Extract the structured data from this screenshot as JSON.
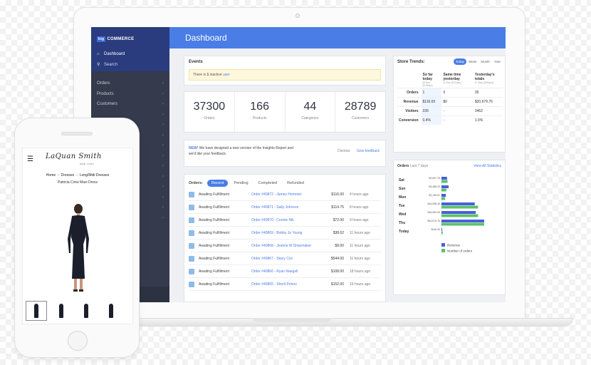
{
  "sidebar": {
    "logo_badge": "big",
    "logo_text": "COMMERCE",
    "dashboard_label": "Dashboard",
    "search_label": "Search",
    "items": [
      "Orders",
      "Products",
      "Customers",
      "",
      "",
      "",
      "",
      "",
      "",
      "",
      "",
      "",
      "",
      ""
    ]
  },
  "header": {
    "title": "Dashboard"
  },
  "events": {
    "title": "Events",
    "alert_pre": "There is",
    "alert_num": "1",
    "alert_mid": "inactive",
    "alert_link": "user"
  },
  "stats": [
    {
      "value": "37300",
      "label": "Orders"
    },
    {
      "value": "166",
      "label": "Products"
    },
    {
      "value": "44",
      "label": "Categories"
    },
    {
      "value": "28789",
      "label": "Customers"
    }
  ],
  "news": {
    "tag": "NEW!",
    "line1": "We have designed a new version of the Insights Report and",
    "line2": "we'd like your feedback.",
    "dismiss": "Dismiss",
    "feedback": "Give feedback"
  },
  "orders": {
    "title": "Orders:",
    "tabs": [
      "Recent",
      "Pending",
      "Completed",
      "Refunded"
    ],
    "rows": [
      {
        "status": "Awaiting Fulfillment",
        "order": "Order #40872 - James Hommer",
        "amount": "$116.00",
        "ago": "4 hours ago"
      },
      {
        "status": "Awaiting Fulfillment",
        "order": "Order #40871 - Sally Johnson",
        "amount": "$114.75",
        "ago": "8 hours ago"
      },
      {
        "status": "Awaiting Fulfillment",
        "order": "Order #40870 - Connie Nik",
        "amount": "$72.00",
        "ago": "9 hours ago"
      },
      {
        "status": "Awaiting Fulfillment",
        "order": "Order #40869 - Bobby Jo Young",
        "amount": "$38.62",
        "ago": "11 hours ago"
      },
      {
        "status": "Awaiting Fulfillment",
        "order": "Order #40868 - Jeanne M Shoemaker",
        "amount": "$9.00",
        "ago": "11 hours ago"
      },
      {
        "status": "Awaiting Fulfillment",
        "order": "Order #40867 - Stacy Cox",
        "amount": "$544.00",
        "ago": "11 hours ago"
      },
      {
        "status": "Awaiting Fulfillment",
        "order": "Order #40866 - Ryan Naegell",
        "amount": "$108.00",
        "ago": "18 hours ago"
      },
      {
        "status": "Awaiting Fulfillment",
        "order": "Order #40865 - Sheril Peters",
        "amount": "$152.00",
        "ago": "19 hours ago"
      }
    ]
  },
  "trends": {
    "title": "Store Trends:",
    "tabs": [
      "Today",
      "Week",
      "Month",
      "Year"
    ],
    "col1": "So far today",
    "col1_sub": "(8 Dec (5:24am)",
    "col2": "Same time yesterday",
    "col2_sub": "(7 Dec (5:24am)",
    "col3": "Yesterday's totals",
    "col3_sub": "(7 Dec) (5:50pm)",
    "rows": [
      {
        "label": "Orders",
        "a": "1",
        "b": "0",
        "c": "35"
      },
      {
        "label": "Revenue",
        "a": "$116.00",
        "b": "$0",
        "c": "$20,679.76"
      },
      {
        "label": "Visitors",
        "a": "235",
        "b": "-",
        "c": "3462"
      },
      {
        "label": "Conversion",
        "a": "0.4%",
        "b": "-",
        "c": "1.0%"
      }
    ]
  },
  "orders_chart": {
    "title": "Orders",
    "subtitle": "Last 7 days",
    "link": "View All Statistics"
  },
  "chart_data": {
    "type": "bar",
    "categories": [
      "Sat",
      "Sun",
      "Mon",
      "Tue",
      "Wed",
      "Thu",
      "Today"
    ],
    "value_labels": [
      "$2,697.75",
      "$3,458.23",
      "$2,136.01",
      "$16,098.40",
      "$16,590.06",
      "$20,679.76",
      "$116.00"
    ],
    "series": [
      {
        "name": "Revenue",
        "values": [
          2697.75,
          3458.23,
          2136.01,
          16098.4,
          16590.06,
          20679.76,
          116.0
        ],
        "color": "#4a5fdc"
      },
      {
        "name": "Number of orders",
        "values": [
          5,
          4,
          3,
          30,
          30,
          35,
          1
        ],
        "color": "#5cc16a"
      }
    ]
  },
  "phone": {
    "brand": "LaQuan Smith",
    "brand_sub": "NEW YORK",
    "crumbs": [
      "Home",
      "Dresses",
      "Long/Midi Dresses"
    ],
    "product": "Patricia Crew Maxi Dress",
    "thumb_count": 4
  }
}
